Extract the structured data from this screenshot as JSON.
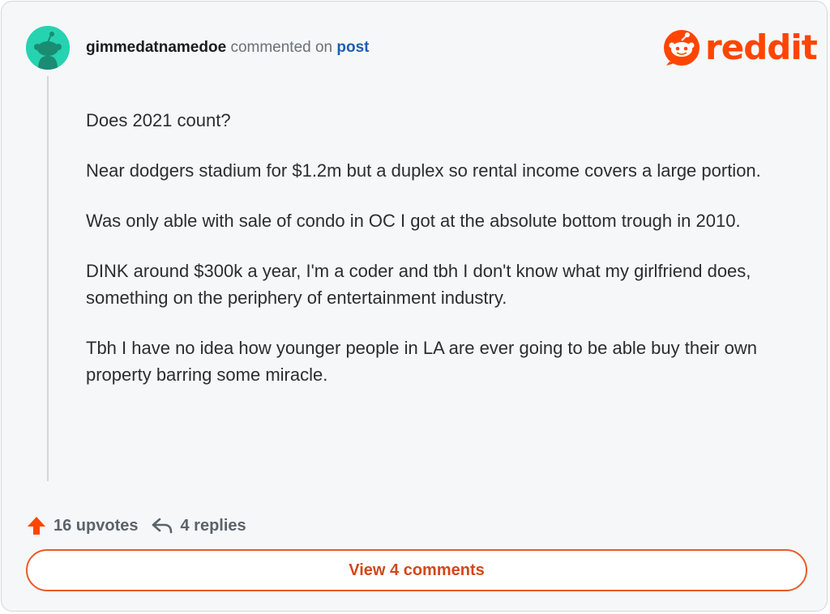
{
  "comment": {
    "username": "gimmedatnamedoe",
    "action_text": "commented on",
    "post_link_text": "post",
    "paragraphs": [
      "Does 2021 count?",
      "Near dodgers stadium for $1.2m but a duplex so rental income covers a large portion.",
      "Was only able with sale of condo in OC I got at the absolute bottom trough in 2010.",
      "DINK around $300k a year, I'm a coder and tbh I don't know what my girlfriend does, something on the periphery of entertainment industry.",
      "Tbh I have no idea how younger people in LA are ever going to be able buy their own property barring some miracle."
    ]
  },
  "brand": {
    "logo_text": "reddit",
    "accent_color": "#ff4500"
  },
  "stats": {
    "upvotes_label": "16 upvotes",
    "replies_label": "4 replies",
    "upvote_icon": "upvote-arrow-icon",
    "reply_icon": "reply-arrow-icon"
  },
  "actions": {
    "view_comments_label": "View 4 comments"
  },
  "colors": {
    "avatar_bg": "#25d3b0",
    "link": "#1a5fb4",
    "button_border": "#ea5a2a"
  }
}
